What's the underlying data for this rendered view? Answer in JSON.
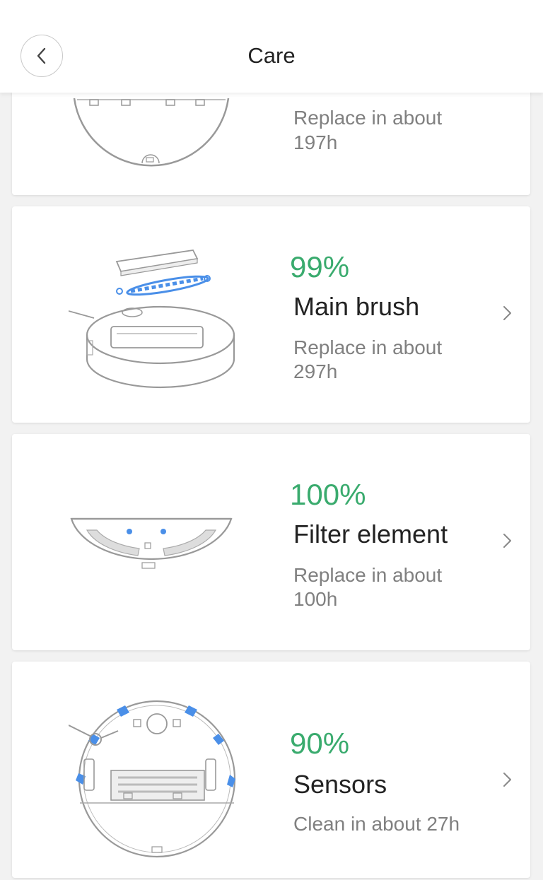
{
  "header": {
    "title": "Care",
    "back_icon": "chevron-left-icon"
  },
  "colors": {
    "percent": "#3aab6e",
    "accent_blue": "#4a8fe8",
    "text_primary": "#222222",
    "text_secondary": "#808080"
  },
  "items": [
    {
      "illustration": "side-brush-robot-icon",
      "sub_line1": "Replace in about",
      "sub_line2": "197h"
    },
    {
      "illustration": "main-brush-icon",
      "percent": "99%",
      "name": "Main brush",
      "sub_line1": "Replace in about",
      "sub_line2": "297h"
    },
    {
      "illustration": "filter-element-icon",
      "percent": "100%",
      "name": "Filter element",
      "sub_line1": "Replace in about",
      "sub_line2": "100h"
    },
    {
      "illustration": "sensors-icon",
      "percent": "90%",
      "name": "Sensors",
      "sub_line1": "Clean in about 27h"
    }
  ]
}
